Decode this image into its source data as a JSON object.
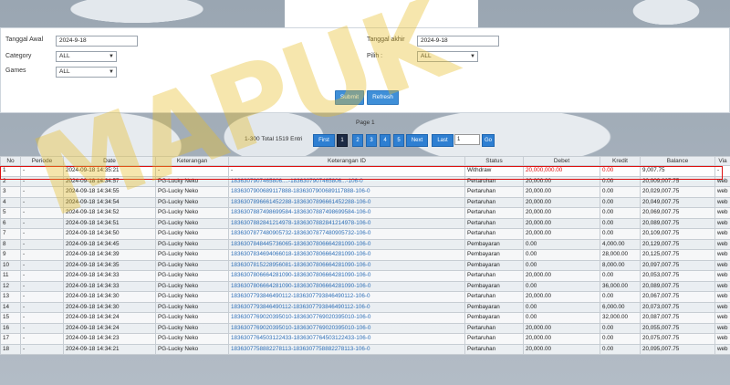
{
  "filters": {
    "tanggal_awal_label": "Tanggal Awal",
    "tanggal_awal_value": "2024-9-18",
    "tanggal_akhir_label": "Tanggal akhir",
    "tanggal_akhir_value": "2024-9-18",
    "category_label": "Category",
    "category_value": "ALL",
    "pilih_label": "Pilih :",
    "pilih_value": "ALL",
    "games_label": "Games",
    "games_value": "ALL",
    "submit_label": "Submit",
    "refresh_label": "Refresh"
  },
  "pager": {
    "title": "Page 1",
    "info": "1-300 Total 1519 Entri",
    "first": "First",
    "pages": [
      "1",
      "2",
      "3",
      "4",
      "5"
    ],
    "next": "Next",
    "last": "Last",
    "input_value": "1",
    "go": "Go"
  },
  "table": {
    "headers": [
      "No",
      "Periode",
      "Date",
      "Keterangan",
      "Keterangan ID",
      "Status",
      "Debet",
      "Kredit",
      "Balance",
      "Via"
    ],
    "rows": [
      [
        "1",
        "-",
        "2024-09-18 14:35:21",
        "-",
        "-",
        "Withdraw",
        "20,000,000.00",
        "0.00",
        "9,007.75",
        "-"
      ],
      [
        "2",
        "-",
        "2024-09-18 14:34:57",
        "PG-Lucky Neko",
        "1836307907465806....-1836307907465806...-106-0",
        "Pertaruhan",
        "20,000.00",
        "0.00",
        "20,009,007.75",
        "web"
      ],
      [
        "3",
        "-",
        "2024-09-18 14:34:55",
        "PG-Lucky Neko",
        "1836307900689117888-1836307900689117888-106-0",
        "Pertaruhan",
        "20,000.00",
        "0.00",
        "20,029,007.75",
        "web"
      ],
      [
        "4",
        "-",
        "2024-09-18 14:34:54",
        "PG-Lucky Neko",
        "1836307896661452288-1836307896661452288-106-0",
        "Pertaruhan",
        "20,000.00",
        "0.00",
        "20,049,007.75",
        "web"
      ],
      [
        "5",
        "-",
        "2024-09-18 14:34:52",
        "PG-Lucky Neko",
        "1836307887498699584-1836307887498699584-106-0",
        "Pertaruhan",
        "20,000.00",
        "0.00",
        "20,069,007.75",
        "web"
      ],
      [
        "6",
        "-",
        "2024-09-18 14:34:51",
        "PG-Lucky Neko",
        "1836307882841214978-1836307882841214978-106-0",
        "Pertaruhan",
        "20,000.00",
        "0.00",
        "20,089,007.75",
        "web"
      ],
      [
        "7",
        "-",
        "2024-09-18 14:34:50",
        "PG-Lucky Neko",
        "1836307877480905732-1836307877480905732-106-0",
        "Pertaruhan",
        "20,000.00",
        "0.00",
        "20,109,007.75",
        "web"
      ],
      [
        "8",
        "-",
        "2024-09-18 14:34:45",
        "PG-Lucky Neko",
        "1836307848445736065-1836307806664281090-106-0",
        "Pembayaran",
        "0.00",
        "4,000.00",
        "20,129,007.75",
        "web"
      ],
      [
        "9",
        "-",
        "2024-09-18 14:34:39",
        "PG-Lucky Neko",
        "1836307834694066018-1836307806664281090-106-0",
        "Pembayaran",
        "0.00",
        "28,000.00",
        "20,125,007.75",
        "web"
      ],
      [
        "10",
        "-",
        "2024-09-18 14:34:35",
        "PG-Lucky Neko",
        "1836307815228956081-1836307806664281090-106-0",
        "Pembayaran",
        "0.00",
        "8,000.00",
        "20,097,007.75",
        "web"
      ],
      [
        "11",
        "-",
        "2024-09-18 14:34:33",
        "PG-Lucky Neko",
        "1836307806664281090-1836307806664281090-106-0",
        "Pertaruhan",
        "20,000.00",
        "0.00",
        "20,053,007.75",
        "web"
      ],
      [
        "12",
        "-",
        "2024-09-18 14:34:33",
        "PG-Lucky Neko",
        "1836307806664281090-1836307806664281090-106-0",
        "Pembayaran",
        "0.00",
        "36,000.00",
        "20,089,007.75",
        "web"
      ],
      [
        "13",
        "-",
        "2024-09-18 14:34:30",
        "PG-Lucky Neko",
        "1836307793846490112-1836307793846490112-106-0",
        "Pertaruhan",
        "20,000.00",
        "0.00",
        "20,067,007.75",
        "web"
      ],
      [
        "14",
        "-",
        "2024-09-18 14:34:30",
        "PG-Lucky Neko",
        "1836307793846490112-1836307793846490112-106-0",
        "Pembayaran",
        "0.00",
        "6,000.00",
        "20,073,007.75",
        "web"
      ],
      [
        "15",
        "-",
        "2024-09-18 14:34:24",
        "PG-Lucky Neko",
        "1836307769020395010-1836307769020395010-106-0",
        "Pembayaran",
        "0.00",
        "32,000.00",
        "20,087,007.75",
        "web"
      ],
      [
        "16",
        "-",
        "2024-09-18 14:34:24",
        "PG-Lucky Neko",
        "1836307769020395010-1836307769020395010-106-0",
        "Pertaruhan",
        "20,000.00",
        "0.00",
        "20,055,007.75",
        "web"
      ],
      [
        "17",
        "-",
        "2024-09-18 14:34:23",
        "PG-Lucky Neko",
        "1836307764503122433-1836307764503122433-106-0",
        "Pertaruhan",
        "20,000.00",
        "0.00",
        "20,075,007.75",
        "web"
      ],
      [
        "18",
        "-",
        "2024-09-18 14:34:21",
        "PG-Lucky Neko",
        "1836307758882278113-1836307758882278113-106-0",
        "Pertaruhan",
        "20,000.00",
        "0.00",
        "20,095,007.75",
        "web"
      ]
    ]
  },
  "watermark": "MAPUK",
  "colors": {
    "primary": "#3f8fd8",
    "pager_active": "#1c2a44",
    "highlight": "#dd1111",
    "link": "#2e6fb7"
  }
}
